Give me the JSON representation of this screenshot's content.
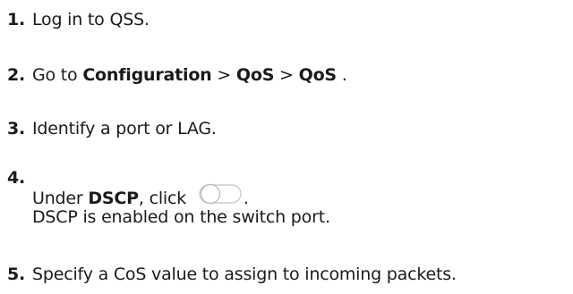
{
  "steps": [
    {
      "number": "1.",
      "text": "Log in to QSS."
    },
    {
      "number": "2.",
      "prefix": "Go to ",
      "path1": "Configuration",
      "sep1": " > ",
      "path2": "QoS",
      "sep2": " > ",
      "path3": "QoS",
      "suffix": " ."
    },
    {
      "number": "3.",
      "text": "Identify a port or LAG."
    },
    {
      "number": "4.",
      "prefix": "Under ",
      "bold": "DSCP",
      "mid": ", click ",
      "suffix": ".",
      "icon": "toggle-switch-off-icon",
      "result": "DSCP is enabled on the switch port."
    },
    {
      "number": "5.",
      "text": "Specify a CoS value to assign to incoming packets."
    }
  ]
}
